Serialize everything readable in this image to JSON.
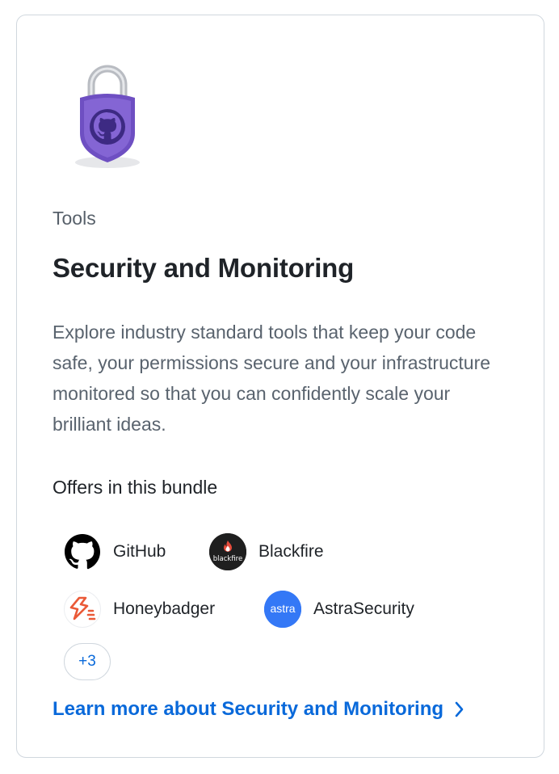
{
  "card": {
    "eyebrow": "Tools",
    "title": "Security and Monitoring",
    "description": "Explore industry standard tools that keep your code safe, your permissions secure and your infrastructure monitored so that you can confidently scale your brilliant ideas.",
    "hero_icon": "padlock-github-icon"
  },
  "offers": {
    "heading": "Offers in this bundle",
    "items": [
      {
        "name": "GitHub",
        "icon": "github-logo-icon"
      },
      {
        "name": "Blackfire",
        "icon": "blackfire-logo-icon",
        "logo_text": "blackfire"
      },
      {
        "name": "Honeybadger",
        "icon": "honeybadger-logo-icon"
      },
      {
        "name": "AstraSecurity",
        "icon": "astra-logo-icon",
        "logo_text": "astra"
      }
    ],
    "more_label": "+3"
  },
  "link": {
    "label": "Learn more about Security and Monitoring",
    "icon": "chevron-right-icon"
  },
  "colors": {
    "accent": "#0969da",
    "hero_purple": "#6e4fc2",
    "honeybadger": "#ea5937",
    "astra": "#3478f6"
  }
}
